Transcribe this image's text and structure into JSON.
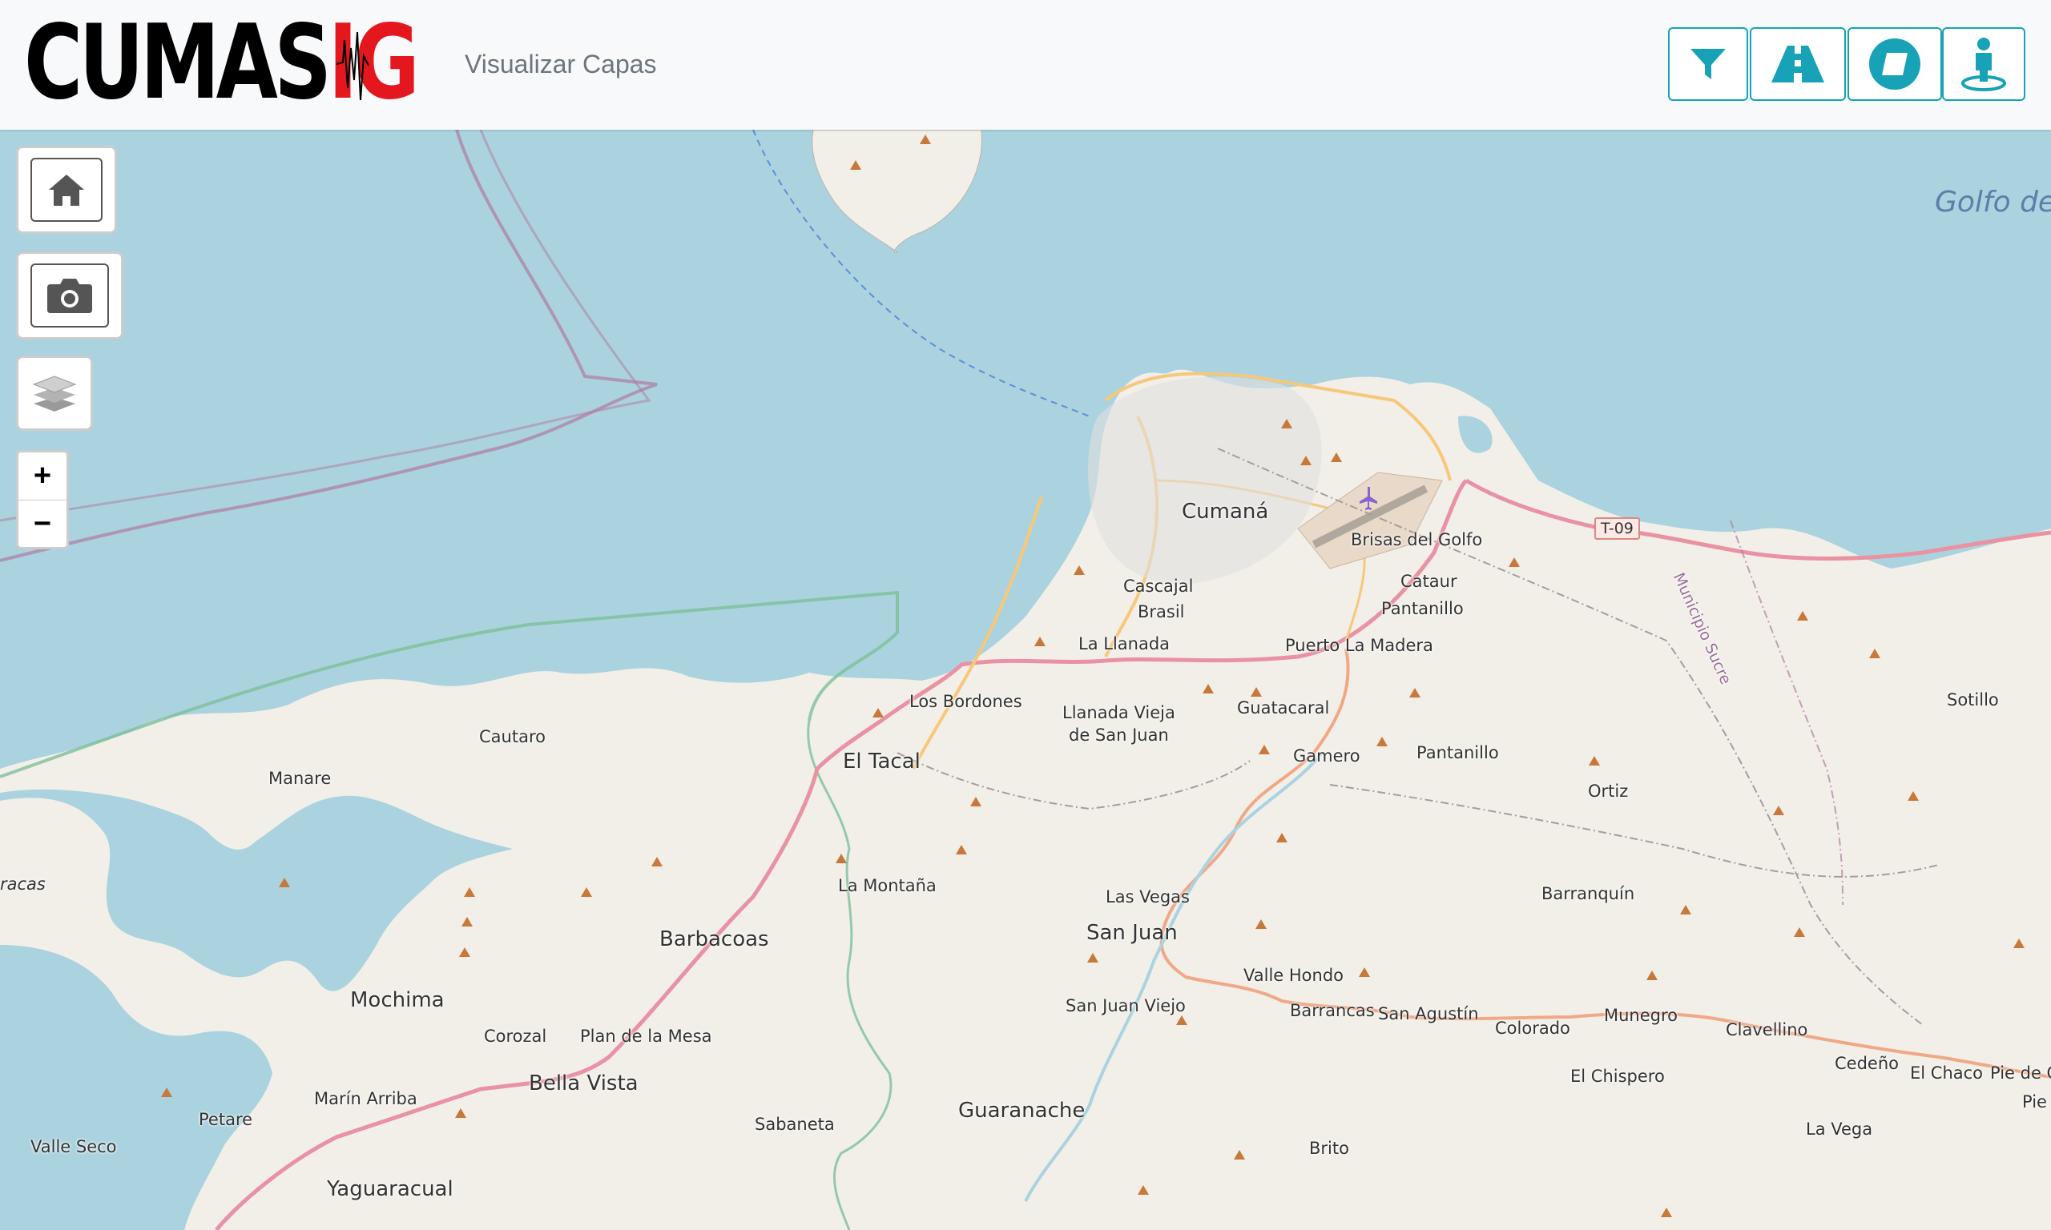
{
  "header": {
    "logo_part1": "CUMAS",
    "logo_part2": "IG",
    "subtitle": "Visualizar Capas"
  },
  "toolbar": {
    "buttons": [
      {
        "name": "filter-button",
        "icon": "filter-icon"
      },
      {
        "name": "road-button",
        "icon": "road-icon"
      },
      {
        "name": "eraser-button",
        "icon": "eraser-icon"
      },
      {
        "name": "street-view-button",
        "icon": "street-view-icon"
      }
    ],
    "accent_color": "#17a2b8"
  },
  "map_controls": {
    "home_icon": "home-icon",
    "camera_icon": "camera-icon",
    "layers_icon": "layers-icon",
    "zoom_in_label": "+",
    "zoom_out_label": "−"
  },
  "map": {
    "sea_label": "Golfo de",
    "route_shield": "T-09",
    "municipio_label": "Municipio Sucre",
    "places": {
      "cumana": "Cumaná",
      "brisas": "Brisas del Golfo",
      "cascajal": "Cascajal",
      "brasil": "Brasil",
      "cataur": "Cataur",
      "pantanillo_n": "Pantanillo",
      "llanada": "La Llanada",
      "puerto_madera": "Puerto La Madera",
      "bordones": "Los Bordones",
      "llanada_vieja1": "Llanada Vieja",
      "llanada_vieja2": "de San Juan",
      "guatacaral": "Guatacaral",
      "gamero": "Gamero",
      "pantanillo_s": "Pantanillo",
      "ortiz": "Ortiz",
      "sotillo": "Sotillo",
      "cautaro": "Cautaro",
      "manare": "Manare",
      "tacal": "El Tacal",
      "montana": "La Montaña",
      "las_vegas": "Las Vegas",
      "san_juan": "San Juan",
      "barranquin": "Barranquín",
      "barbacoas": "Barbacoas",
      "mochima": "Mochima",
      "valle_hondo": "Valle Hondo",
      "san_juan_viejo": "San Juan Viejo",
      "barrancas": "Barrancas",
      "san_agustin": "San Agustín",
      "colorado": "Colorado",
      "munegro": "Munegro",
      "clavellino": "Clavellino",
      "corozal": "Corozal",
      "plan_mesa": "Plan de la Mesa",
      "marin_arriba": "Marín Arriba",
      "bella_vista": "Bella Vista",
      "petare": "Petare",
      "cedeno": "Cedeño",
      "el_chaco": "El Chaco",
      "pie_de_c": "Pie de C",
      "pie_de": "Pie d",
      "chispero": "El Chispero",
      "valle_seco": "Valle Seco",
      "sabaneta": "Sabaneta",
      "guaranache": "Guaranache",
      "la_vega": "La Vega",
      "brito": "Brito",
      "yaguaracual": "Yaguaracual",
      "racas": "racas"
    }
  }
}
